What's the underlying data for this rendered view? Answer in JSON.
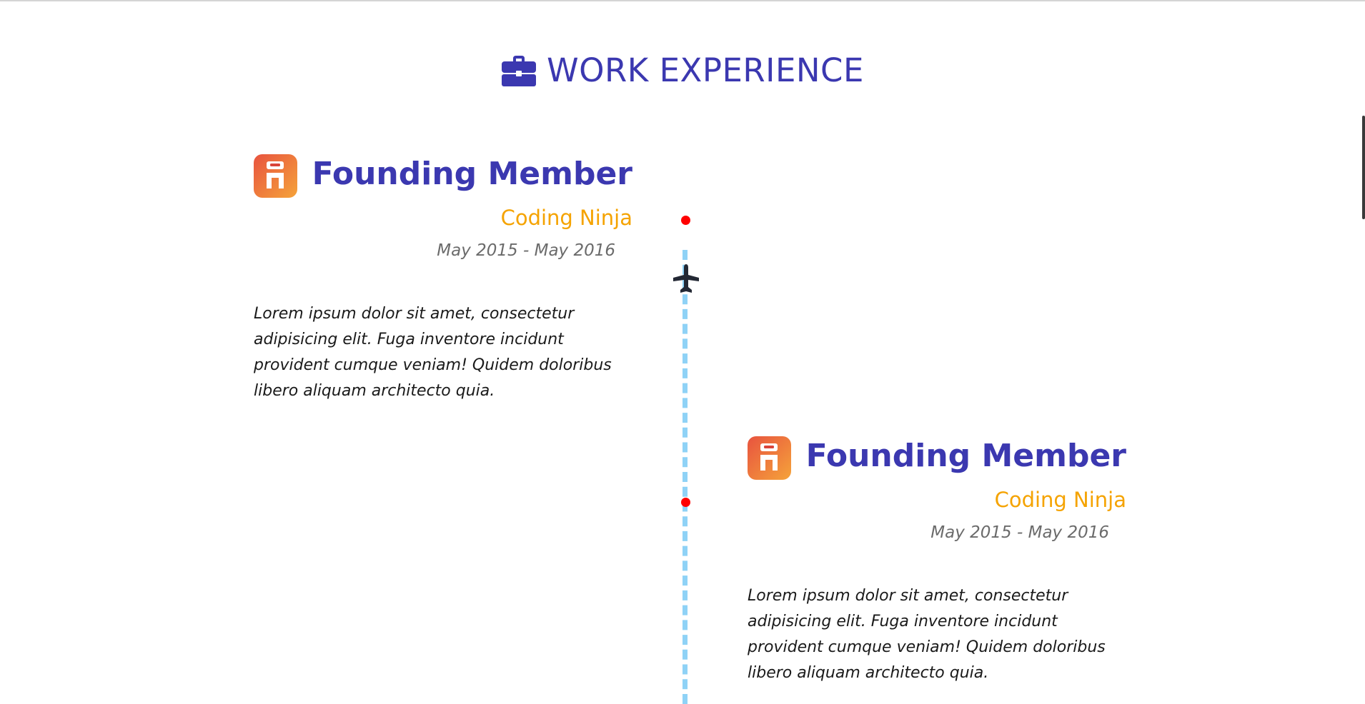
{
  "section": {
    "title": "WORK EXPERIENCE",
    "icon": "briefcase-icon"
  },
  "colors": {
    "accent": "#3b38b0",
    "company": "#f5a300",
    "dot": "#ff0000",
    "timeline": "#8fd2f6"
  },
  "entries": [
    {
      "title": "Founding Member",
      "company": "Coding Ninja",
      "dates": "May 2015 - May 2016",
      "description": "Lorem ipsum dolor sit amet, consectetur adipisicing elit. Fuga inventore incidunt provident cumque veniam! Quidem doloribus libero aliquam architecto quia.",
      "logo": "coding-ninja-logo"
    },
    {
      "title": "Founding Member",
      "company": "Coding Ninja",
      "dates": "May 2015 - May 2016",
      "description": "Lorem ipsum dolor sit amet, consectetur adipisicing elit. Fuga inventore incidunt provident cumque veniam! Quidem doloribus libero aliquam architecto quia.",
      "logo": "coding-ninja-logo"
    }
  ],
  "timeline": {
    "marker_icon": "airplane-icon"
  }
}
